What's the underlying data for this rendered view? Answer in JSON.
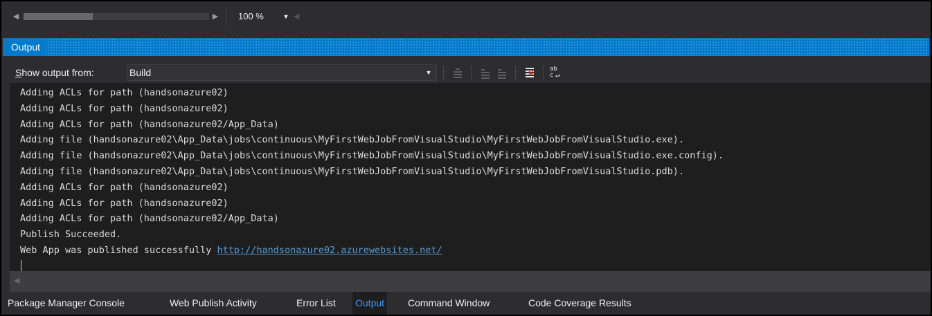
{
  "topbar": {
    "zoom_value": "100 %"
  },
  "output_window": {
    "title": "Output",
    "show_output_from_label_accel": "S",
    "show_output_from_label_rest": "how output from:",
    "source_value": "Build",
    "toolbar_icons": [
      "goto-previous-message-icon",
      "find-previous-icon",
      "find-next-icon",
      "clear-all-icon",
      "toggle-word-wrap-icon"
    ]
  },
  "output_lines": [
    "Adding ACLs for path (handsonazure02)",
    "Adding ACLs for path (handsonazure02)",
    "Adding ACLs for path (handsonazure02/App_Data)",
    "Adding file (handsonazure02\\App_Data\\jobs\\continuous\\MyFirstWebJobFromVisualStudio\\MyFirstWebJobFromVisualStudio.exe).",
    "Adding file (handsonazure02\\App_Data\\jobs\\continuous\\MyFirstWebJobFromVisualStudio\\MyFirstWebJobFromVisualStudio.exe.config).",
    "Adding file (handsonazure02\\App_Data\\jobs\\continuous\\MyFirstWebJobFromVisualStudio\\MyFirstWebJobFromVisualStudio.pdb).",
    "Adding ACLs for path (handsonazure02)",
    "Adding ACLs for path (handsonazure02)",
    "Adding ACLs for path (handsonazure02/App_Data)",
    "Publish Succeeded."
  ],
  "final_line": {
    "prefix": "Web App was published successfully ",
    "link": "http://handsonazure02.azurewebsites.net/"
  },
  "tabs": [
    "Package Manager Console",
    "Web Publish Activity",
    "Error List",
    "Output",
    "Command Window",
    "Code Coverage Results"
  ],
  "active_tab": "Output",
  "colors": {
    "accent": "#007acc",
    "link": "#569cd6",
    "active_tab_text": "#3399ff",
    "clear_icon_x": "#e51400"
  }
}
